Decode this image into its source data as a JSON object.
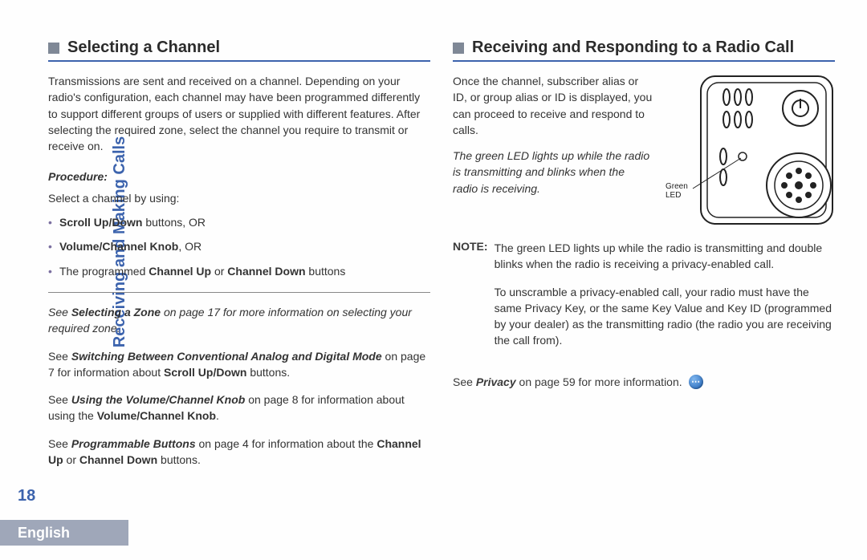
{
  "sidebar_label": "Receiving and Making Calls",
  "page_number": "18",
  "footer_language": "English",
  "left": {
    "heading": "Selecting a Channel",
    "intro": "Transmissions are sent and received on a channel. Depending on your radio's configuration, each channel may have been programmed differently to support different groups of users or supplied with different features. After selecting the required zone, select the channel you require to transmit or receive on.",
    "procedure_label": "Procedure:",
    "procedure_lead": "Select a channel by using:",
    "bullets": [
      {
        "b": "Scroll Up/Down",
        "t": " buttons, OR"
      },
      {
        "b": "Volume/Channel Knob",
        "t": ", OR"
      },
      {
        "pre": "The programmed ",
        "b": "Channel Up",
        "mid": " or ",
        "b2": "Channel Down",
        "t": " buttons"
      }
    ],
    "refs": {
      "r1a": "See ",
      "r1b": "Selecting a Zone",
      "r1c": " on page 17 for more information on selecting your required zone.",
      "r2a": "See ",
      "r2b": "Switching Between Conventional Analog and Digital Mode",
      "r2c": " on page 7 for information about ",
      "r2d": "Scroll Up/Down",
      "r2e": " buttons.",
      "r3a": "See ",
      "r3b": "Using the Volume/Channel Knob",
      "r3c": " on page 8 for information about using the ",
      "r3d": "Volume/Channel Knob",
      "r3e": ".",
      "r4a": "See ",
      "r4b": "Programmable Buttons",
      "r4c": " on page 4 for information about the ",
      "r4d": "Channel Up",
      "r4e": " or ",
      "r4f": "Channel Down",
      "r4g": " buttons."
    }
  },
  "right": {
    "heading": "Receiving and Responding to a Radio Call",
    "p1": "Once the channel, subscriber alias or ID, or group alias or ID is displayed, you can proceed to receive and respond to calls.",
    "p2": "The green LED lights up while the radio is transmitting and blinks when the radio is receiving.",
    "led_label_l1": "Green",
    "led_label_l2": "LED",
    "note_key": "NOTE:",
    "note_p1": "The green LED lights up while the radio is transmitting and double blinks when the radio is receiving a privacy-enabled call.",
    "note_p2": "To unscramble a privacy-enabled call, your radio must have the same Privacy Key, or the same Key Value and Key ID (programmed by your dealer) as the transmitting radio (the radio you are receiving the call from).",
    "see_privacy_a": "See ",
    "see_privacy_b": "Privacy",
    "see_privacy_c": " on page 59 for more information."
  }
}
